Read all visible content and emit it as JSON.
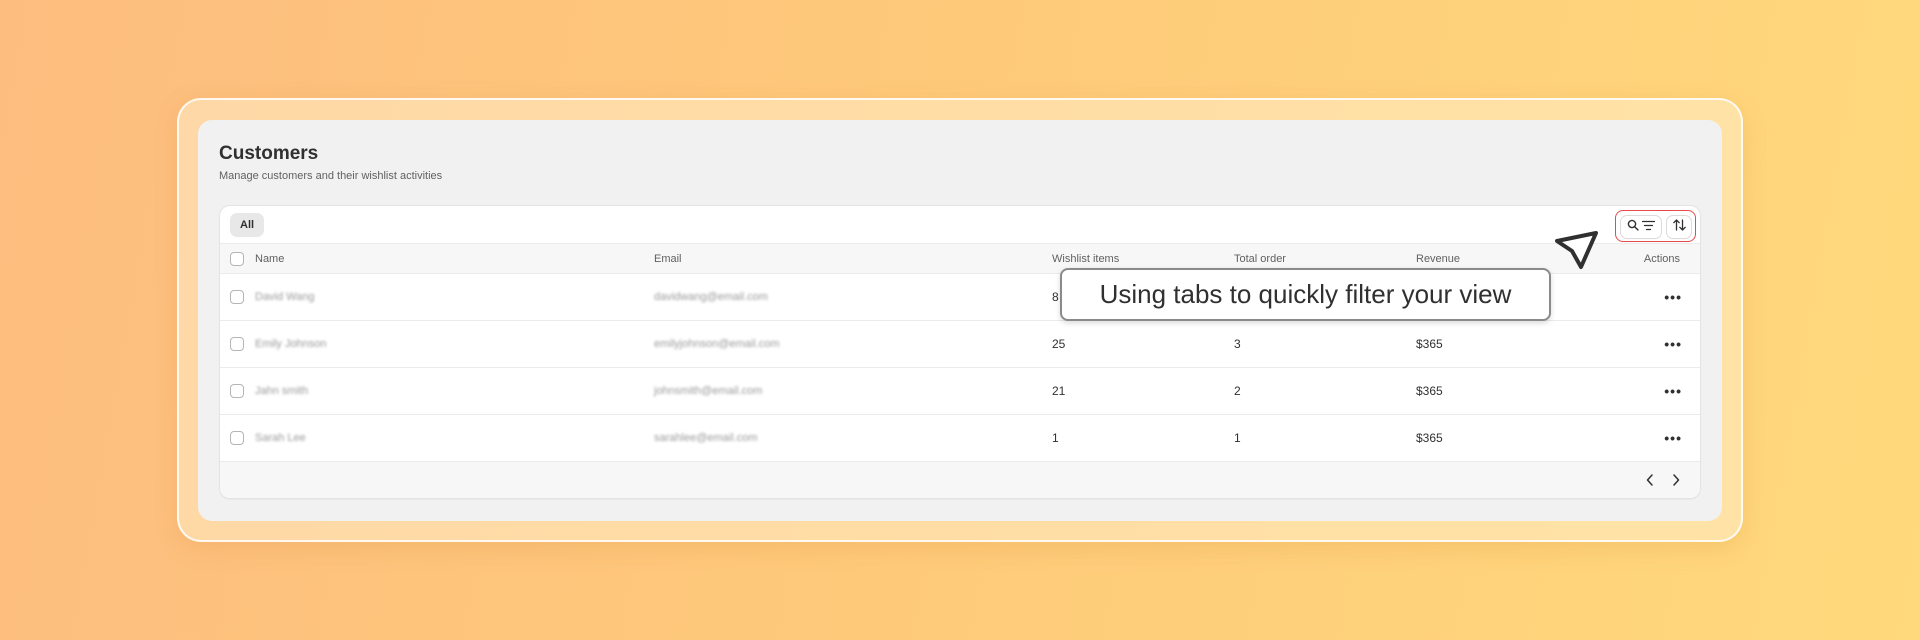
{
  "page": {
    "title": "Customers",
    "subtitle": "Manage customers and their wishlist activities"
  },
  "tabs": [
    {
      "label": "All",
      "selected": true
    }
  ],
  "toolbar": {
    "search_icon": "search-icon",
    "filter_icon": "filter-lines-icon",
    "sort_icon": "sort-arrows-icon",
    "highlight_color": "#e64a4a"
  },
  "table": {
    "columns": [
      "Name",
      "Email",
      "Wishlist items",
      "Total order",
      "Revenue",
      "Actions"
    ],
    "rows": [
      {
        "name": "David Wang",
        "email": "davidwang@email.com",
        "wishlist": "8",
        "total": "",
        "revenue": ""
      },
      {
        "name": "Emily Johnson",
        "email": "emilyjohnson@email.com",
        "wishlist": "25",
        "total": "3",
        "revenue": "$365"
      },
      {
        "name": "Jahn smith",
        "email": "johnsmith@email.com",
        "wishlist": "21",
        "total": "2",
        "revenue": "$365"
      },
      {
        "name": "Sarah Lee",
        "email": "sarahlee@email.com",
        "wishlist": "1",
        "total": "1",
        "revenue": "$365"
      }
    ]
  },
  "pagination": {
    "prev_icon": "chevron-left-icon",
    "next_icon": "chevron-right-icon"
  },
  "tooltip": {
    "text": "Using tabs to quickly filter your view"
  },
  "colors": {
    "background_start": "#fdbd7f",
    "background_end": "#ffd97c",
    "text_primary": "#303030"
  }
}
